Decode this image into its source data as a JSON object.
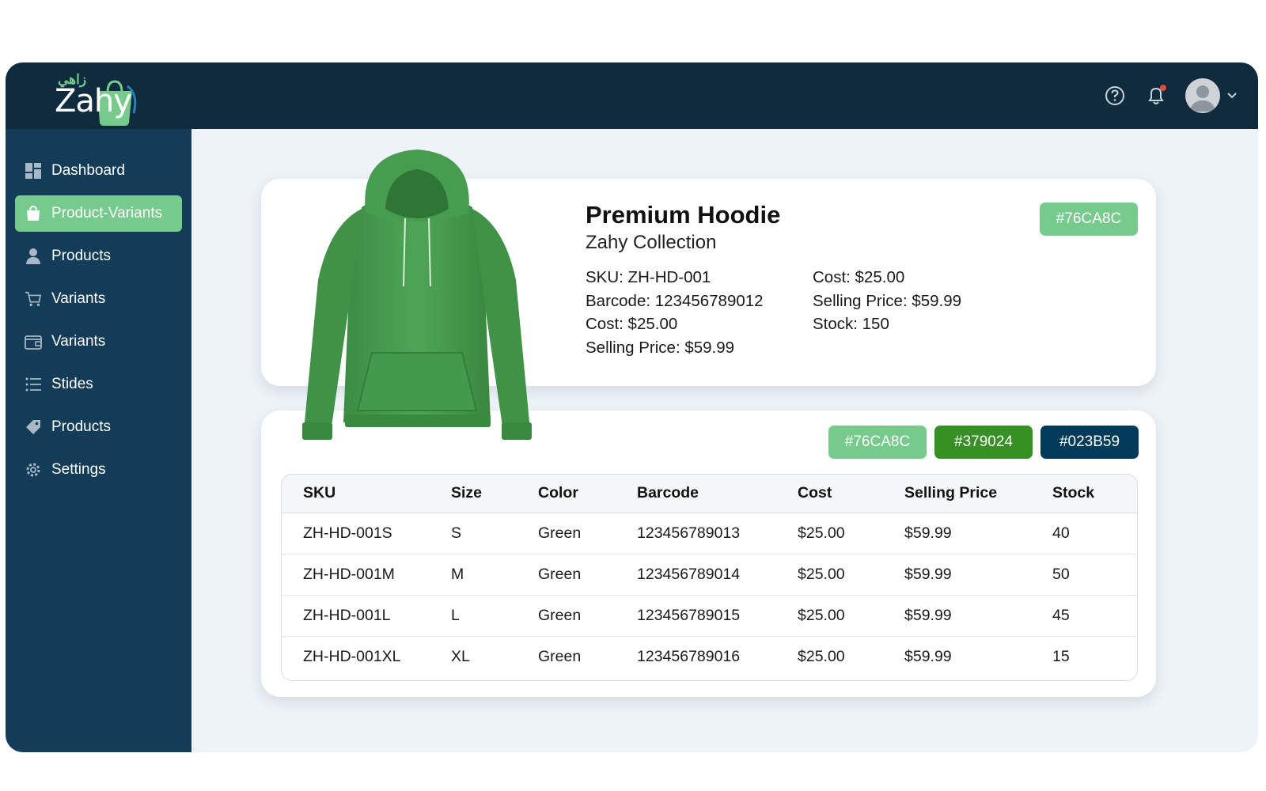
{
  "brand": {
    "logo_arabic": "زاهي",
    "logo_text": "Zahy"
  },
  "colors": {
    "accent": "#76CA8C",
    "dark_green": "#379024",
    "navy": "#023B59",
    "topbar": "#0f2b3d",
    "sidebar": "#123c58"
  },
  "topbar": {
    "icons": [
      "help-icon",
      "bell-icon",
      "avatar",
      "chevron-down-icon"
    ],
    "has_notification": true
  },
  "sidebar": {
    "items": [
      {
        "label": "Dashboard",
        "icon": "dashboard-icon",
        "active": false
      },
      {
        "label": "Product-Variants",
        "icon": "shopping-bag-icon",
        "active": true
      },
      {
        "label": "Products",
        "icon": "user-icon",
        "active": false
      },
      {
        "label": "Variants",
        "icon": "cart-icon",
        "active": false
      },
      {
        "label": "Variants",
        "icon": "wallet-icon",
        "active": false
      },
      {
        "label": "Stides",
        "icon": "list-icon",
        "active": false
      },
      {
        "label": "Products",
        "icon": "tag-icon",
        "active": false
      },
      {
        "label": "Settings",
        "icon": "gear-icon",
        "active": false
      }
    ]
  },
  "product": {
    "title": "Premium Hoodie",
    "collection": "Zahy Collection",
    "color_chip": "#76CA8C",
    "details_left": [
      "SKU: ZH-HD-001",
      "Barcode: 123456789012",
      "Cost: $25.00",
      "Selling Price: $59.99"
    ],
    "details_right": [
      "Cost: $25.00",
      "Selling Price: $59.99",
      "Stock: 150"
    ]
  },
  "color_chips": [
    "#76CA8C",
    "#379024",
    "#023B59"
  ],
  "variants_table": {
    "columns": [
      "SKU",
      "Size",
      "Color",
      "Barcode",
      "Cost",
      "Selling Price",
      "Stock"
    ],
    "rows": [
      [
        "ZH-HD-001S",
        "S",
        "Green",
        "123456789013",
        "$25.00",
        "$59.99",
        "40"
      ],
      [
        "ZH-HD-001M",
        "M",
        "Green",
        "123456789014",
        "$25.00",
        "$59.99",
        "50"
      ],
      [
        "ZH-HD-001L",
        "L",
        "Green",
        "123456789015",
        "$25.00",
        "$59.99",
        "45"
      ],
      [
        "ZH-HD-001XL",
        "XL",
        "Green",
        "123456789016",
        "$25.00",
        "$59.99",
        "15"
      ]
    ]
  }
}
